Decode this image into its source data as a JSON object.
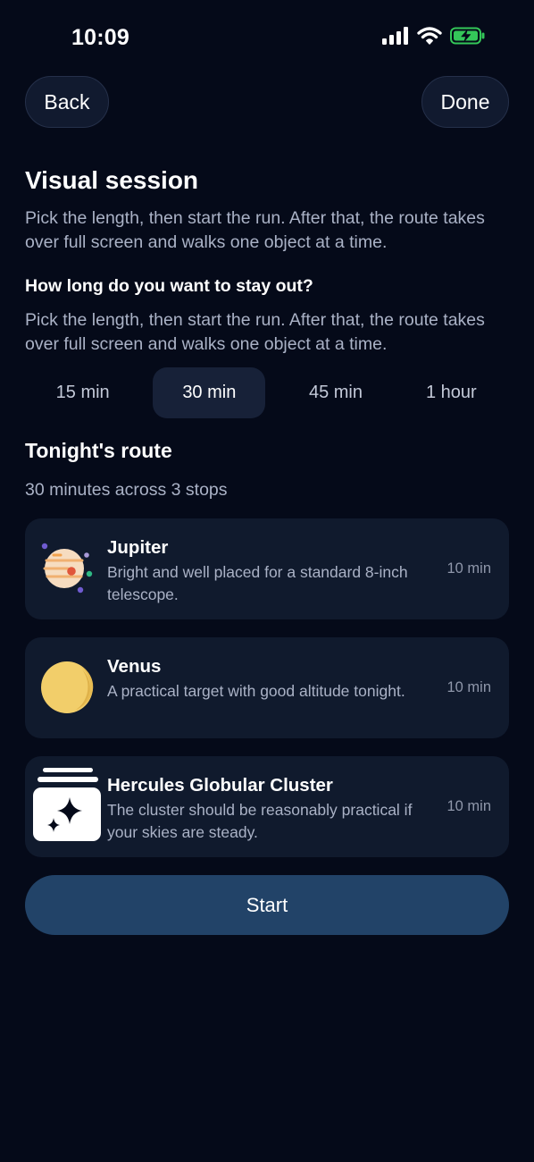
{
  "status_bar": {
    "time": "10:09",
    "icons": [
      "cellular-signal-icon",
      "wifi-icon",
      "battery-charging-icon"
    ]
  },
  "header": {
    "back_label": "Back",
    "done_label": "Done"
  },
  "session": {
    "title": "Visual session",
    "description": "Pick the length, then start the run. After that, the route takes over full screen and walks one object at a time.",
    "question": "How long do you want to stay out?",
    "question_description": "Pick the length, then start the run. After that, the route takes over full screen and walks one object at a time."
  },
  "durations": {
    "options": [
      "15 min",
      "30 min",
      "45 min",
      "1 hour"
    ],
    "selected": "30 min"
  },
  "route": {
    "title": "Tonight's route",
    "summary": "30 minutes across 3 stops",
    "stops": [
      {
        "name": "Jupiter",
        "description": "Bright and well placed for a standard 8-inch telescope.",
        "duration": "10 min",
        "icon": "jupiter-icon"
      },
      {
        "name": "Venus",
        "description": "A practical target with good altitude tonight.",
        "duration": "10 min",
        "icon": "venus-icon"
      },
      {
        "name": "Hercules Globular Cluster",
        "description": "The cluster should be reasonably practical if your skies are steady.",
        "duration": "10 min",
        "icon": "star-cluster-icon"
      }
    ]
  },
  "actions": {
    "start_label": "Start"
  },
  "colors": {
    "background": "#050a19",
    "card": "#101a2d",
    "accent_button": "#224368",
    "battery": "#34c759"
  }
}
